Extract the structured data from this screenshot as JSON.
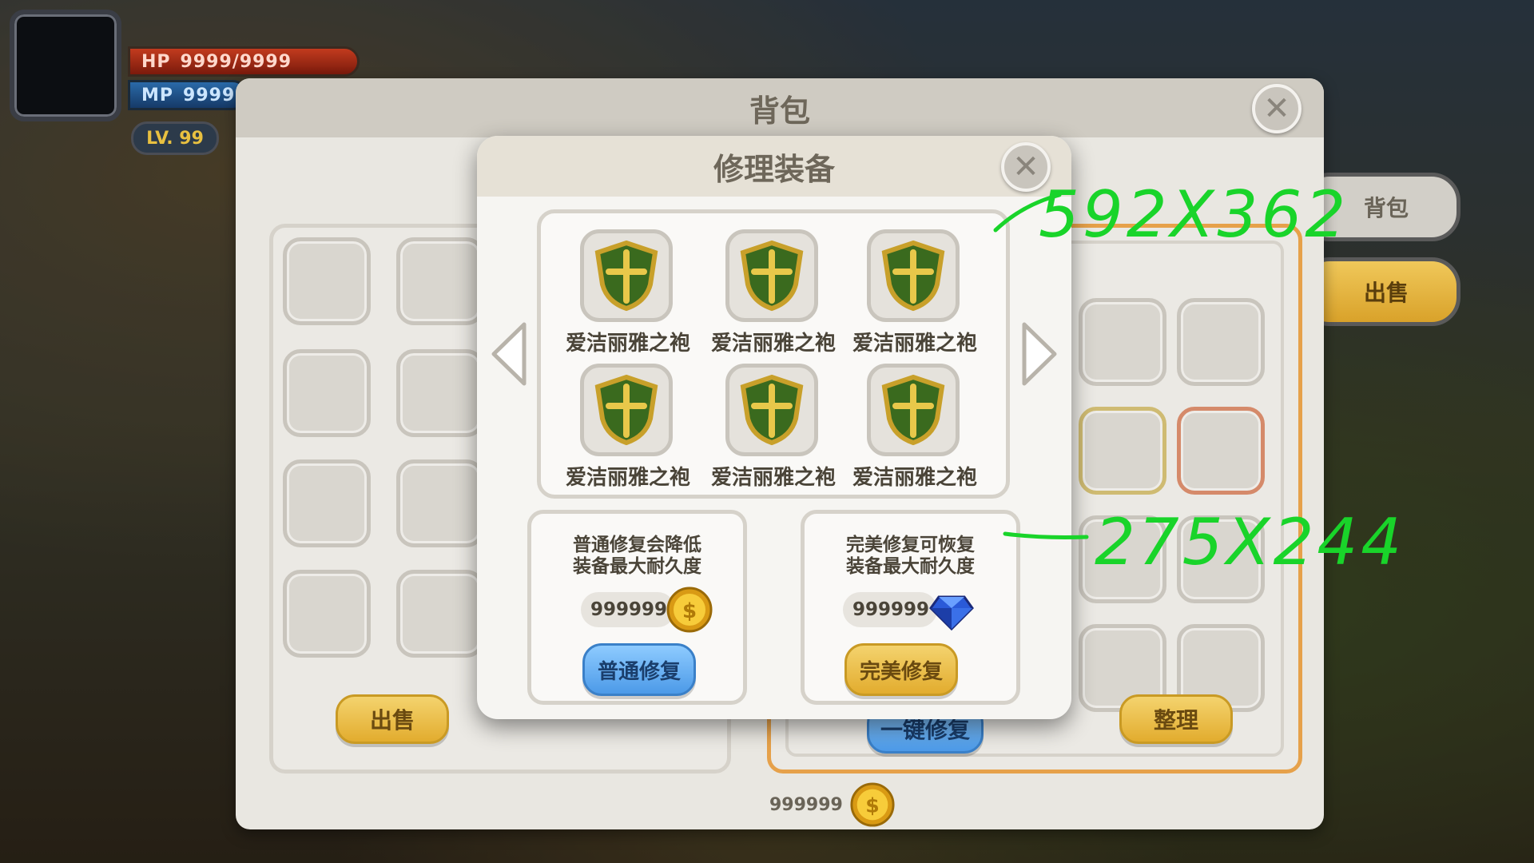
{
  "hud": {
    "hp_label": "HP",
    "hp_value": "9999/9999",
    "mp_label": "MP",
    "mp_value": "9999",
    "level": "LV. 99"
  },
  "backpack": {
    "title": "背包",
    "sell_label": "出售",
    "sort_label": "整理",
    "repair_all_label": "一键修复",
    "coin_amount": "999999",
    "side_tabs": [
      "背包",
      "出售"
    ]
  },
  "repair_dialog": {
    "title": "修理装备",
    "items": [
      {
        "name": "爱洁丽雅之袍"
      },
      {
        "name": "爱洁丽雅之袍"
      },
      {
        "name": "爱洁丽雅之袍"
      },
      {
        "name": "爱洁丽雅之袍"
      },
      {
        "name": "爱洁丽雅之袍"
      },
      {
        "name": "爱洁丽雅之袍"
      }
    ],
    "normal": {
      "desc_line1": "普通修复会降低",
      "desc_line2": "装备最大耐久度",
      "cost": "999999",
      "button": "普通修复"
    },
    "perfect": {
      "desc_line1": "完美修复可恢复",
      "desc_line2": "装备最大耐久度",
      "cost": "999999",
      "button": "完美修复"
    }
  },
  "annotations": {
    "size_equip": "592X362",
    "size_card": "275X244"
  },
  "colors": {
    "annotation": "#19d42a",
    "gold_button": "#e2ac2e",
    "blue_button": "#4c9ae8"
  }
}
